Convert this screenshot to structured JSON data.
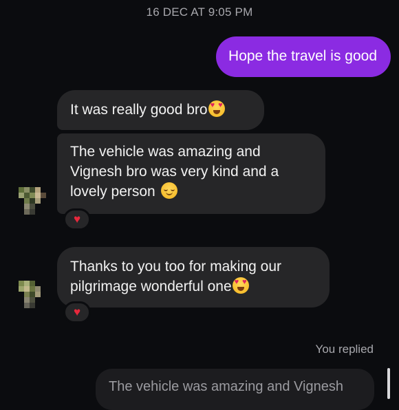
{
  "conversation": {
    "date_header": "16 DEC AT 9:05 PM",
    "messages": [
      {
        "direction": "outgoing",
        "text": "Hope the travel is good"
      },
      {
        "direction": "incoming",
        "text": "It was really good bro",
        "emoji": "heart-eyes-emoji"
      },
      {
        "direction": "incoming",
        "text": "The vehicle was amazing and Vignesh bro was very kind and a lovely person",
        "emoji": "relieved-smile-emoji",
        "reaction": "♥"
      },
      {
        "direction": "incoming",
        "text": "Thanks to you too for making our pilgrimage wonderful one",
        "emoji": "heart-eyes-emoji",
        "reaction": "♥"
      }
    ],
    "reply": {
      "label": "You replied",
      "quoted_text": "The vehicle was amazing and Vignesh"
    }
  },
  "colors": {
    "background": "#0b0c0f",
    "outgoing_bubble": "#8b2be2",
    "incoming_bubble": "#262628",
    "reaction_heart": "#e8283c",
    "secondary_text": "#a8a8ad"
  }
}
